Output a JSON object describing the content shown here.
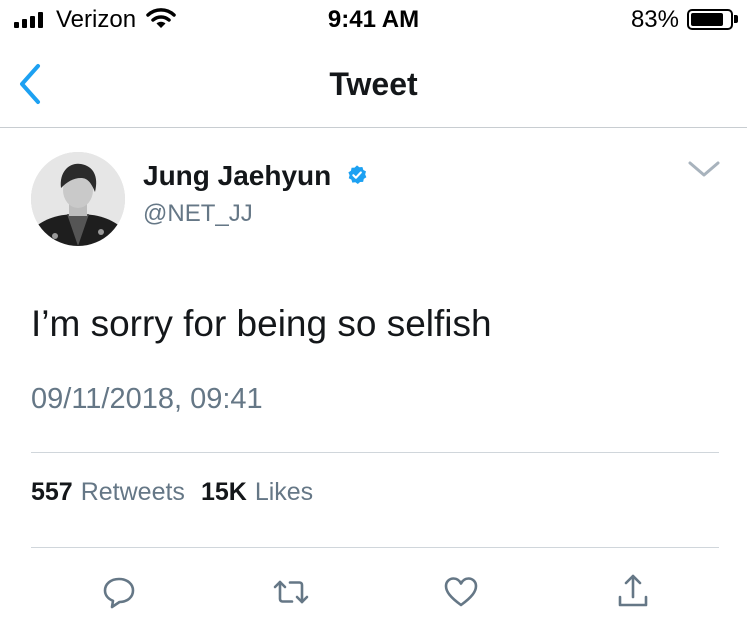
{
  "status_bar": {
    "carrier": "Verizon",
    "time": "9:41 AM",
    "battery_percent": "83%",
    "battery_level": 0.83,
    "icons": [
      "signal-icon",
      "wifi-icon",
      "battery-icon"
    ]
  },
  "nav": {
    "title": "Tweet",
    "back_icon": "chevron-left-icon",
    "accent_color": "#1da1f2"
  },
  "tweet": {
    "display_name": "Jung Jaehyun",
    "handle": "@NET_JJ",
    "verified_icon": "verified-badge-icon",
    "verified_color": "#1da1f2",
    "menu_icon": "chevron-down-icon",
    "text": "I’m sorry for being so selfish",
    "timestamp": "09/11/2018, 09:41",
    "retweets_count": "557",
    "retweets_label": "Retweets",
    "likes_count": "15K",
    "likes_label": "Likes"
  },
  "actions": [
    {
      "name": "reply",
      "icon": "comment-icon"
    },
    {
      "name": "retweet",
      "icon": "retweet-icon"
    },
    {
      "name": "like",
      "icon": "heart-icon"
    },
    {
      "name": "share",
      "icon": "share-icon"
    }
  ],
  "colors": {
    "text_primary": "#14171a",
    "text_secondary": "#657786",
    "icon_gray": "#657786"
  }
}
